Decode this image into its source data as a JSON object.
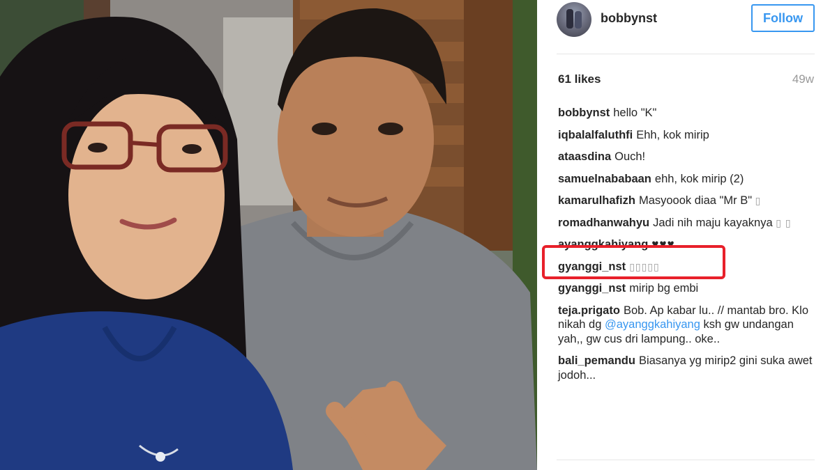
{
  "post": {
    "username": "bobbynst",
    "follow_label": "Follow",
    "likes": "61 likes",
    "time": "49w"
  },
  "comments": [
    {
      "user": "bobbynst",
      "text": "hello \"K\""
    },
    {
      "user": "iqbalalfaluthfi",
      "text": "Ehh, kok mirip"
    },
    {
      "user": "ataasdina",
      "text": "Ouch!"
    },
    {
      "user": "samuelnababaan",
      "text": "ehh, kok mirip (2)"
    },
    {
      "user": "kamarulhafizh",
      "text": "Masyoook diaa \"Mr B\"",
      "trailing": "▯"
    },
    {
      "user": "romadhanwahyu",
      "text": "Jadi nih maju kayaknya",
      "trailing": "▯ ▯"
    },
    {
      "user": "ayanggkahiyang",
      "text": "♥♥♥"
    },
    {
      "user": "gyanggi_nst",
      "text": "",
      "trailing": "▯▯▯▯▯"
    },
    {
      "user": "gyanggi_nst",
      "text": "mirip bg embi"
    },
    {
      "user": "teja.prigato",
      "text_before": "Bob. Ap kabar lu.. // mantab bro. Klo nikah dg",
      "mention": "@ayanggkahiyang",
      "text_after": "ksh gw undangan yah,, gw cus dri lampung.. oke.."
    },
    {
      "user": "bali_pemandu",
      "text": "Biasanya yg mirip2 gini suka awet jodoh..."
    }
  ],
  "colors": {
    "accent": "#3897f0",
    "highlight": "#e8202a",
    "muted": "#999999",
    "text": "#262626"
  },
  "icons": {
    "avatar": "profile-avatar"
  }
}
